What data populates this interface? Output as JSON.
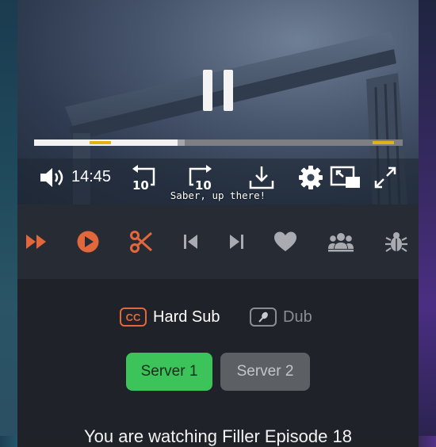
{
  "player": {
    "time": "14:45",
    "subtitle": "Saber, up there!",
    "progress": {
      "played": 0.389,
      "buffered": 0.408
    },
    "chapter_marks": [
      {
        "start": 0.151,
        "end": 0.209
      },
      {
        "start": 0.918,
        "end": 0.976
      }
    ],
    "controls": [
      "volume-icon",
      "rewind-10-icon",
      "forward-10-icon",
      "download-icon",
      "settings-icon",
      "picture-in-picture-icon",
      "fullscreen-icon"
    ],
    "accent": "#e0b316"
  },
  "toolbar": {
    "items": [
      "auto-next-icon",
      "autoplay-icon",
      "auto-skip-icon",
      "previous-episode-icon",
      "next-episode-icon",
      "favorite-icon",
      "watch-together-icon",
      "report-icon"
    ],
    "accent": "#e2673b",
    "muted": "#a9abb0"
  },
  "audio": {
    "sub_badge": "CC",
    "sub_label": "Hard Sub",
    "dub_label": "Dub"
  },
  "servers": {
    "server1": "Server 1",
    "server2": "Server 2",
    "active_color": "#3cc35a"
  },
  "watching_text": "You are watching Filler Episode 18"
}
